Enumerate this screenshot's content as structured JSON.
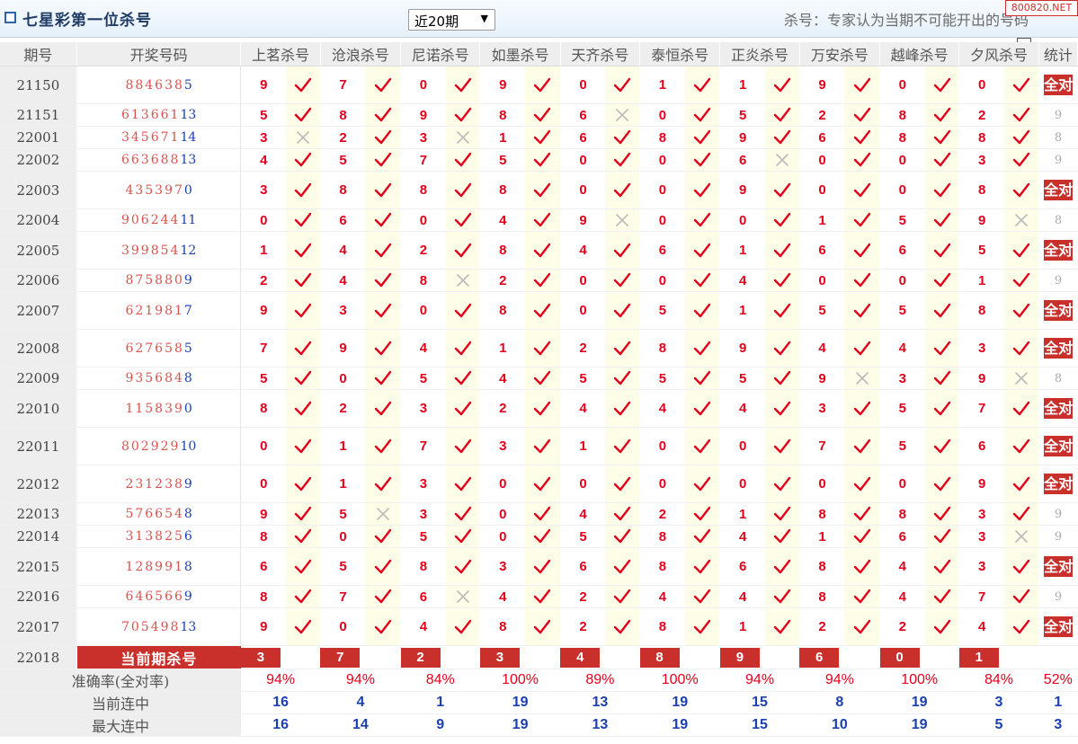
{
  "header": {
    "title": "七星彩第一位杀号",
    "period_select": "近20期",
    "note": "杀号：专家认为当期不可能开出的号码",
    "watermark": "800820.NET"
  },
  "columns": {
    "issue": "期号",
    "draw": "开奖号码",
    "experts": [
      "上茗杀号",
      "沧浪杀号",
      "尼诺杀号",
      "如墨杀号",
      "天齐杀号",
      "泰恒杀号",
      "正炎杀号",
      "万安杀号",
      "越峰杀号",
      "夕风杀号"
    ],
    "stat": "统计"
  },
  "rows": [
    {
      "issue": "21150",
      "draw": "884638",
      "draw_b": "5",
      "kills": [
        "9",
        "7",
        "0",
        "9",
        "0",
        "1",
        "1",
        "9",
        "0",
        "0"
      ],
      "hits": [
        1,
        1,
        1,
        1,
        1,
        1,
        1,
        1,
        1,
        1
      ],
      "stat": "全对",
      "all": true,
      "h": 42
    },
    {
      "issue": "21151",
      "draw": "613661",
      "draw_b": "13",
      "kills": [
        "5",
        "8",
        "9",
        "8",
        "6",
        "0",
        "5",
        "2",
        "8",
        "2"
      ],
      "hits": [
        1,
        1,
        1,
        1,
        0,
        1,
        1,
        1,
        1,
        1
      ],
      "stat": "9",
      "all": false,
      "h": 25
    },
    {
      "issue": "22001",
      "draw": "345671",
      "draw_b": "14",
      "kills": [
        "3",
        "2",
        "3",
        "1",
        "6",
        "8",
        "9",
        "6",
        "8",
        "8"
      ],
      "hits": [
        0,
        1,
        0,
        1,
        1,
        1,
        1,
        1,
        1,
        1
      ],
      "stat": "8",
      "all": false,
      "h": 25
    },
    {
      "issue": "22002",
      "draw": "663688",
      "draw_b": "13",
      "kills": [
        "4",
        "5",
        "7",
        "5",
        "0",
        "0",
        "6",
        "0",
        "0",
        "3"
      ],
      "hits": [
        1,
        1,
        1,
        1,
        1,
        1,
        0,
        1,
        1,
        1
      ],
      "stat": "9",
      "all": false,
      "h": 25
    },
    {
      "issue": "22003",
      "draw": "435397",
      "draw_b": "0",
      "kills": [
        "3",
        "8",
        "8",
        "8",
        "0",
        "0",
        "9",
        "0",
        "0",
        "8"
      ],
      "hits": [
        1,
        1,
        1,
        1,
        1,
        1,
        1,
        1,
        1,
        1
      ],
      "stat": "全对",
      "all": true,
      "h": 42
    },
    {
      "issue": "22004",
      "draw": "906244",
      "draw_b": "11",
      "kills": [
        "0",
        "6",
        "0",
        "4",
        "9",
        "0",
        "0",
        "1",
        "5",
        "9"
      ],
      "hits": [
        1,
        1,
        1,
        1,
        0,
        1,
        1,
        1,
        1,
        0
      ],
      "stat": "8",
      "all": false,
      "h": 25
    },
    {
      "issue": "22005",
      "draw": "399854",
      "draw_b": "12",
      "kills": [
        "1",
        "4",
        "2",
        "8",
        "4",
        "6",
        "1",
        "6",
        "6",
        "5"
      ],
      "hits": [
        1,
        1,
        1,
        1,
        1,
        1,
        1,
        1,
        1,
        1
      ],
      "stat": "全对",
      "all": true,
      "h": 42
    },
    {
      "issue": "22006",
      "draw": "875880",
      "draw_b": "9",
      "kills": [
        "2",
        "4",
        "8",
        "2",
        "0",
        "0",
        "4",
        "0",
        "0",
        "1"
      ],
      "hits": [
        1,
        1,
        0,
        1,
        1,
        1,
        1,
        1,
        1,
        1
      ],
      "stat": "9",
      "all": false,
      "h": 25
    },
    {
      "issue": "22007",
      "draw": "621981",
      "draw_b": "7",
      "kills": [
        "9",
        "3",
        "0",
        "8",
        "0",
        "5",
        "1",
        "5",
        "5",
        "8"
      ],
      "hits": [
        1,
        1,
        1,
        1,
        1,
        1,
        1,
        1,
        1,
        1
      ],
      "stat": "全对",
      "all": true,
      "h": 42
    },
    {
      "issue": "22008",
      "draw": "627658",
      "draw_b": "5",
      "kills": [
        "7",
        "9",
        "4",
        "1",
        "2",
        "8",
        "9",
        "4",
        "4",
        "3"
      ],
      "hits": [
        1,
        1,
        1,
        1,
        1,
        1,
        1,
        1,
        1,
        1
      ],
      "stat": "全对",
      "all": true,
      "h": 42
    },
    {
      "issue": "22009",
      "draw": "935684",
      "draw_b": "8",
      "kills": [
        "5",
        "0",
        "5",
        "4",
        "5",
        "5",
        "5",
        "9",
        "3",
        "9"
      ],
      "hits": [
        1,
        1,
        1,
        1,
        1,
        1,
        1,
        0,
        1,
        0
      ],
      "stat": "8",
      "all": false,
      "h": 25
    },
    {
      "issue": "22010",
      "draw": "115839",
      "draw_b": "0",
      "kills": [
        "8",
        "2",
        "3",
        "2",
        "4",
        "4",
        "4",
        "3",
        "5",
        "7"
      ],
      "hits": [
        1,
        1,
        1,
        1,
        1,
        1,
        1,
        1,
        1,
        1
      ],
      "stat": "全对",
      "all": true,
      "h": 42
    },
    {
      "issue": "22011",
      "draw": "802929",
      "draw_b": "10",
      "kills": [
        "0",
        "1",
        "7",
        "3",
        "1",
        "0",
        "0",
        "7",
        "5",
        "6"
      ],
      "hits": [
        1,
        1,
        1,
        1,
        1,
        1,
        1,
        1,
        1,
        1
      ],
      "stat": "全对",
      "all": true,
      "h": 42
    },
    {
      "issue": "22012",
      "draw": "231238",
      "draw_b": "9",
      "kills": [
        "0",
        "1",
        "3",
        "0",
        "0",
        "0",
        "0",
        "0",
        "0",
        "9"
      ],
      "hits": [
        1,
        1,
        1,
        1,
        1,
        1,
        1,
        1,
        1,
        1
      ],
      "stat": "全对",
      "all": true,
      "h": 42
    },
    {
      "issue": "22013",
      "draw": "576654",
      "draw_b": "8",
      "kills": [
        "9",
        "5",
        "3",
        "0",
        "4",
        "2",
        "1",
        "8",
        "8",
        "3"
      ],
      "hits": [
        1,
        0,
        1,
        1,
        1,
        1,
        1,
        1,
        1,
        1
      ],
      "stat": "9",
      "all": false,
      "h": 25
    },
    {
      "issue": "22014",
      "draw": "313825",
      "draw_b": "6",
      "kills": [
        "8",
        "0",
        "5",
        "0",
        "5",
        "8",
        "4",
        "1",
        "6",
        "3"
      ],
      "hits": [
        1,
        1,
        1,
        1,
        1,
        1,
        1,
        1,
        1,
        0
      ],
      "stat": "9",
      "all": false,
      "h": 25
    },
    {
      "issue": "22015",
      "draw": "128991",
      "draw_b": "8",
      "kills": [
        "6",
        "5",
        "8",
        "3",
        "6",
        "8",
        "6",
        "8",
        "4",
        "3"
      ],
      "hits": [
        1,
        1,
        1,
        1,
        1,
        1,
        1,
        1,
        1,
        1
      ],
      "stat": "全对",
      "all": true,
      "h": 42
    },
    {
      "issue": "22016",
      "draw": "646566",
      "draw_b": "9",
      "kills": [
        "8",
        "7",
        "6",
        "4",
        "2",
        "4",
        "4",
        "8",
        "4",
        "7"
      ],
      "hits": [
        1,
        1,
        0,
        1,
        1,
        1,
        1,
        1,
        1,
        1
      ],
      "stat": "9",
      "all": false,
      "h": 25
    },
    {
      "issue": "22017",
      "draw": "705498",
      "draw_b": "13",
      "kills": [
        "9",
        "0",
        "4",
        "8",
        "2",
        "8",
        "1",
        "2",
        "2",
        "4"
      ],
      "hits": [
        1,
        1,
        1,
        1,
        1,
        1,
        1,
        1,
        1,
        1
      ],
      "stat": "全对",
      "all": true,
      "h": 42
    }
  ],
  "current": {
    "issue": "22018",
    "label": "当前期杀号",
    "kills": [
      "3",
      "7",
      "2",
      "3",
      "4",
      "8",
      "9",
      "6",
      "0",
      "1"
    ]
  },
  "summary": [
    {
      "label": "准确率(全对率)",
      "values": [
        "94%",
        "94%",
        "84%",
        "100%",
        "89%",
        "100%",
        "94%",
        "94%",
        "100%",
        "84%"
      ],
      "stat": "52%",
      "style": "red"
    },
    {
      "label": "当前连中",
      "values": [
        "16",
        "4",
        "1",
        "19",
        "13",
        "19",
        "15",
        "8",
        "19",
        "3"
      ],
      "stat": "1",
      "style": "blue"
    },
    {
      "label": "最大连中",
      "values": [
        "16",
        "14",
        "9",
        "19",
        "13",
        "19",
        "15",
        "10",
        "19",
        "5"
      ],
      "stat": "3",
      "style": "blue"
    }
  ],
  "colors": {
    "accent_red": "#c9302c",
    "kill_red": "#e3001b",
    "check_red": "#e3001b",
    "miss_gray": "#bbbbbb",
    "blue": "#1b3fb0"
  }
}
